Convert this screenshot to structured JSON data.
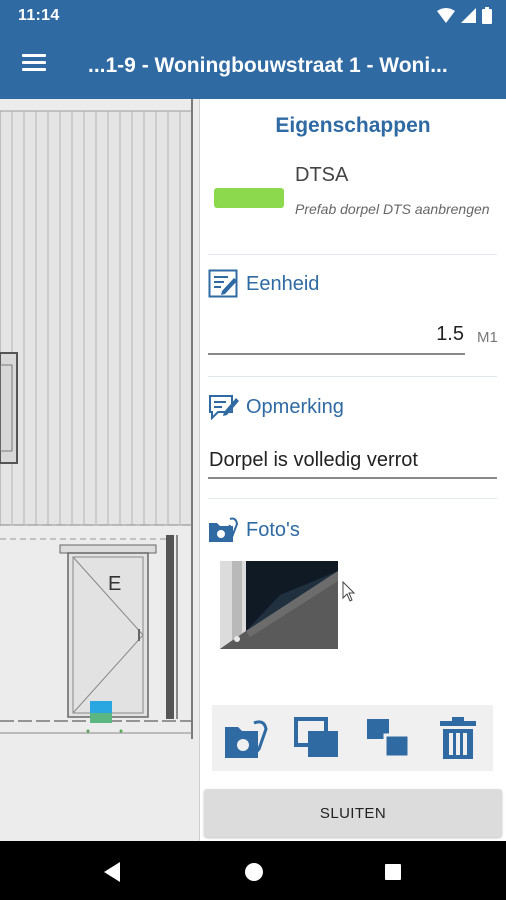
{
  "status_bar": {
    "time": "11:14",
    "icons": [
      "wifi-icon",
      "signal-icon",
      "battery-icon"
    ]
  },
  "app_bar": {
    "title": "...1-9 - Woningbouwstraat 1 - Woni..."
  },
  "drawing": {
    "door_label": "E"
  },
  "panel": {
    "heading": "Eigenschappen",
    "item": {
      "code": "DTSA",
      "description": "Prefab dorpel DTS aanbrengen",
      "color": "#8cd94e"
    },
    "unit_section": {
      "title": "Eenheid",
      "value": "1.5",
      "suffix": "M1"
    },
    "note_section": {
      "title": "Opmerking",
      "value": "Dorpel is volledig verrot"
    },
    "photo_section": {
      "title": "Foto's"
    },
    "actions": [
      "attach-photo-icon",
      "copy-icon",
      "duplicate-icon",
      "delete-icon"
    ],
    "close_label": "SLUITEN"
  },
  "colors": {
    "primary": "#2f6aa3",
    "accent_green": "#8cd94e"
  }
}
